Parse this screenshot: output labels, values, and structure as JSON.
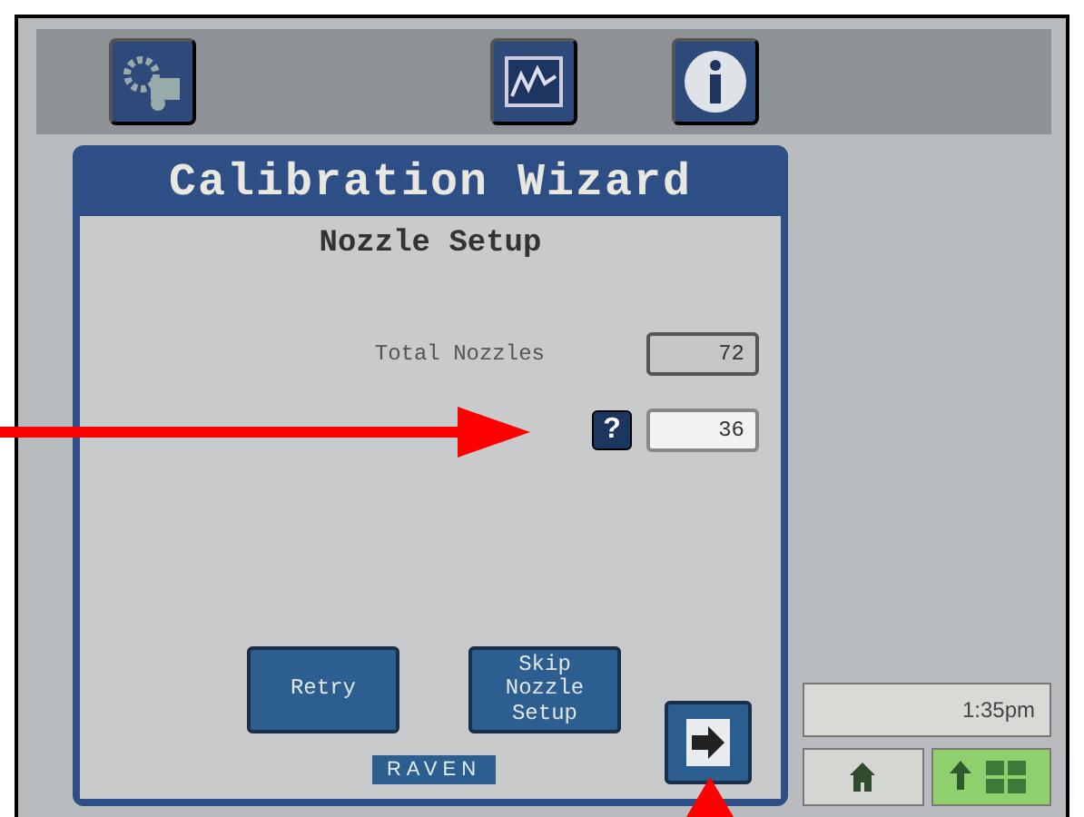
{
  "wizard": {
    "title": "Calibration Wizard",
    "subtitle": "Nozzle Setup",
    "fields": [
      {
        "label": "Total Nozzles",
        "value": "72",
        "editable": false
      },
      {
        "value": "36",
        "editable": true,
        "help": "?"
      }
    ],
    "buttons": [
      "Retry",
      "Skip Nozzle Setup"
    ],
    "logo": "RAVEN"
  },
  "clock": "1:35pm",
  "nav_tabs": [
    {
      "kind": "home",
      "selected": false
    },
    {
      "kind": "up",
      "selected": true
    }
  ]
}
